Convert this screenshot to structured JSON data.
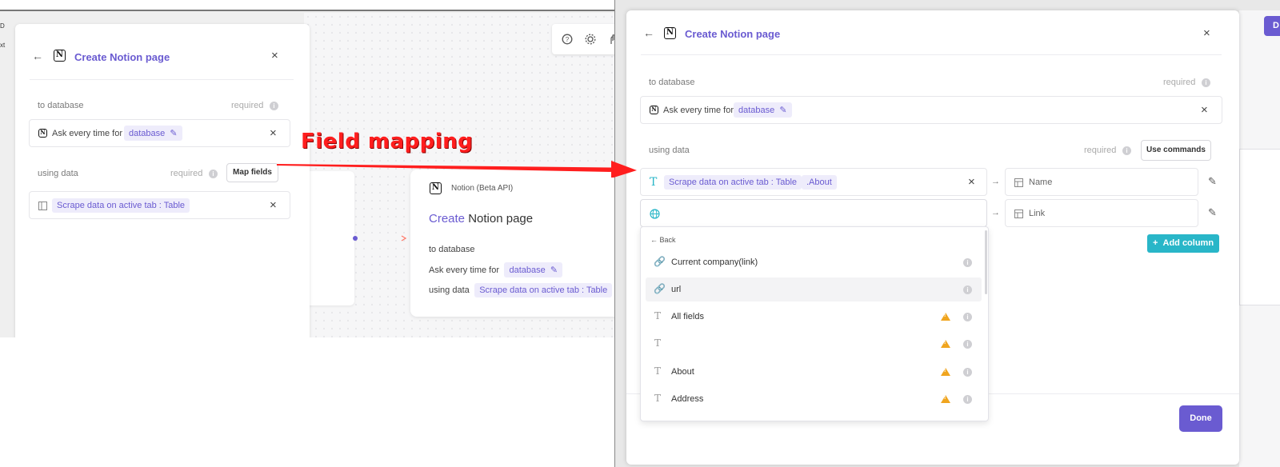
{
  "annotation": {
    "label": "Field mapping"
  },
  "left": {
    "edge_texts": [
      "D",
      "xt"
    ],
    "panel": {
      "title": "Create Notion page",
      "to_database_label": "to database",
      "required_label": "required",
      "database_prefix": "Ask every time for",
      "database_chip": "database",
      "using_data_label": "using data",
      "map_fields_button": "Map fields",
      "source_chip": "Scrape data on active tab : Table"
    },
    "node": {
      "subtitle": "Notion (Beta API)",
      "title_action": "Create",
      "title_object": "Notion page",
      "to_database_label": "to database",
      "database_prefix": "Ask every time for",
      "database_chip": "database",
      "using_data_label": "using data",
      "source_chip": "Scrape data on active tab : Table"
    }
  },
  "right": {
    "panel": {
      "title": "Create Notion page",
      "to_database_label": "to database",
      "required_label": "required",
      "database_prefix": "Ask every time for",
      "database_chip": "database",
      "using_data_label": "using data",
      "use_commands_button": "Use commands",
      "mapping_source_chip": "Scrape data on active tab : Table",
      "mapping_field_chip": ".About",
      "target_name": "Name",
      "target_link": "Link",
      "add_column_button": "Add column",
      "done_button": "Done",
      "top_right_button": "D"
    },
    "dropdown": {
      "back_label": "Back",
      "items": [
        {
          "label": "Current company(link)",
          "icon": "link-icon",
          "warning": false
        },
        {
          "label": "url",
          "icon": "link-icon",
          "warning": false
        },
        {
          "label": "All fields",
          "icon": "text-icon",
          "warning": true
        },
        {
          "label": "",
          "icon": "text-icon",
          "warning": true
        },
        {
          "label": "About",
          "icon": "text-icon",
          "warning": true
        },
        {
          "label": "Address",
          "icon": "text-icon",
          "warning": true
        }
      ]
    }
  },
  "colors": {
    "accent": "#6a5bd1",
    "chip_bg": "#eeecfb",
    "teal": "#29b6c8",
    "warning": "#f0a51f",
    "annotation": "#ff1e1e"
  }
}
